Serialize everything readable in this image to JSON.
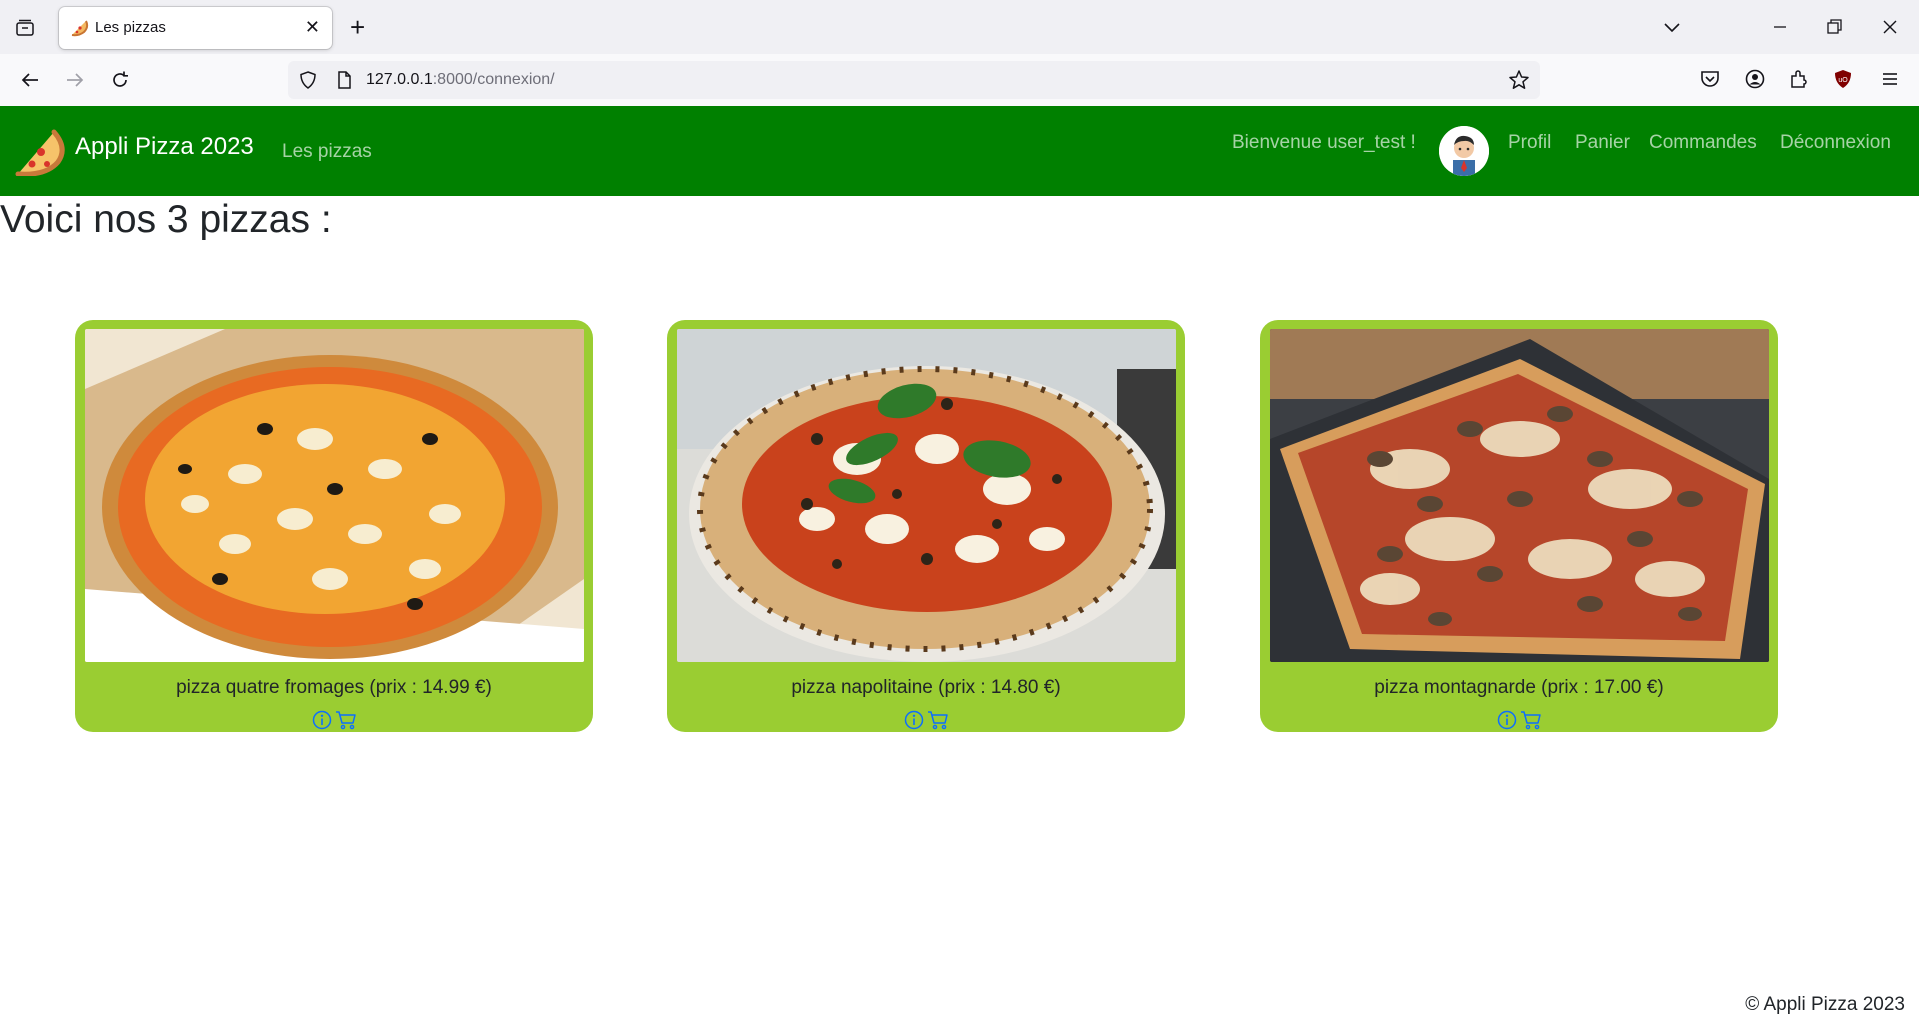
{
  "browser": {
    "tab_title": "Les pizzas",
    "url_host": "127.0.0.1",
    "url_rest": ":8000/connexion/"
  },
  "site": {
    "brand": "Appli Pizza 2023",
    "nav_link": "Les pizzas",
    "welcome": "Bienvenue user_test !",
    "menu": {
      "profile": "Profil",
      "cart": "Panier",
      "orders": "Commandes",
      "logout": "Déconnexion"
    }
  },
  "page": {
    "title": "Voici nos 3 pizzas :",
    "pizzas": [
      {
        "caption": "pizza quatre fromages (prix : 14.99 €)"
      },
      {
        "caption": "pizza napolitaine (prix : 14.80 €)"
      },
      {
        "caption": "pizza montagnarde (prix : 17.00 €)"
      }
    ]
  },
  "footer": {
    "text": "© Appli Pizza 2023"
  },
  "colors": {
    "navbar": "#008000",
    "card": "#9acd32",
    "action_icons": "#0d6efd"
  },
  "icons": [
    "tab-list-icon",
    "pizza-favicon-icon",
    "close-icon",
    "plus-icon",
    "chevron-down-icon",
    "minimize-icon",
    "restore-icon",
    "back-icon",
    "forward-icon",
    "reload-icon",
    "shield-icon",
    "page-icon",
    "bookmark-star-icon",
    "pocket-icon",
    "account-icon",
    "extensions-icon",
    "ublock-icon",
    "menu-icon",
    "pizza-logo-icon",
    "info-icon",
    "cart-icon"
  ]
}
